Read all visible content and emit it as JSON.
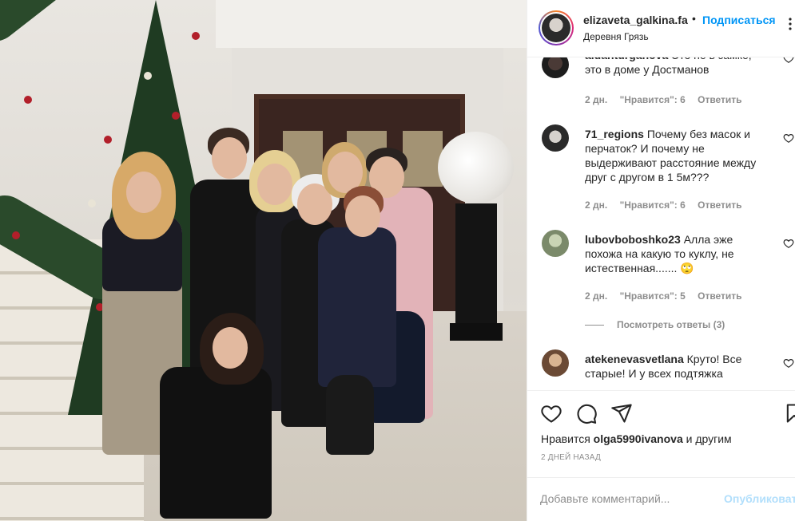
{
  "post": {
    "username": "elizaveta_galkina.fa",
    "separator": "•",
    "follow_label": "Подписаться",
    "location": "Деревня Грязь"
  },
  "comments": [
    {
      "username": "aidanturganova",
      "text": "Это не в замке, это в доме у Достманов",
      "age": "2 дн.",
      "likes": "\"Нравится\": 6",
      "reply": "Ответить"
    },
    {
      "username": "71_regions",
      "text": "Почему без масок и перчаток? И почему не выдерживают расстояние между друг с другом в 1 5м???",
      "age": "2 дн.",
      "likes": "\"Нравится\": 6",
      "reply": "Ответить"
    },
    {
      "username": "lubovboboshko23",
      "text": "Алла эже похожа на какую то куклу, не истественная....... 🙄",
      "age": "2 дн.",
      "likes": "\"Нравится\": 5",
      "reply": "Ответить",
      "view_replies": "Посмотреть ответы (3)"
    },
    {
      "username": "atekenevasvetlana",
      "text": "Круто! Все старые! И у всех подтяжка"
    }
  ],
  "likes": {
    "prefix": "Нравится",
    "user": "olga5990ivanova",
    "suffix": "и другим"
  },
  "date": "2 ДНЕЙ НАЗАД",
  "composer": {
    "placeholder": "Добавьте комментарий...",
    "publish_label": "Опубликовать"
  },
  "colors": {
    "link_blue": "#0095f6",
    "publish_disabled": "#b2dffc",
    "meta_gray": "#8e8e8e"
  },
  "icons": [
    "heart-icon",
    "comment-icon",
    "share-icon",
    "bookmark-icon",
    "more-options-icon"
  ]
}
